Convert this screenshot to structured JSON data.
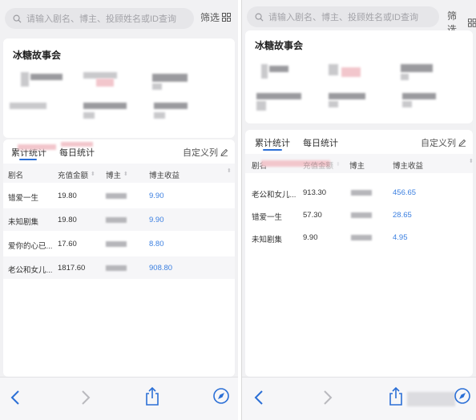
{
  "left": {
    "search": {
      "placeholder": "请输入剧名、博主、投顾姓名或ID查询"
    },
    "filter_label": "筛选",
    "header_title": "冰糖故事会",
    "tabs": [
      {
        "label": "累计统计"
      },
      {
        "label": "每日统计"
      }
    ],
    "customize_label": "自定义列",
    "columns": [
      "剧名",
      "充值金额",
      "博主",
      "博主收益"
    ],
    "rows": [
      {
        "title": "错爱一生",
        "amount": "19.80",
        "earnings": "9.90"
      },
      {
        "title": "未知剧集",
        "amount": "19.80",
        "earnings": "9.90"
      },
      {
        "title": "爱你的心已...",
        "amount": "17.60",
        "earnings": "8.80"
      },
      {
        "title": "老公和女儿...",
        "amount": "1817.60",
        "earnings": "908.80"
      }
    ]
  },
  "right": {
    "search": {
      "placeholder": "请输入剧名、博主、投顾姓名或ID查询"
    },
    "filter_label": "筛选",
    "header_title": "冰糖故事会",
    "tabs": [
      {
        "label": "累计统计"
      },
      {
        "label": "每日统计"
      }
    ],
    "customize_label": "自定义列",
    "columns": [
      "剧名",
      "充值金额",
      "博主",
      "博主收益"
    ],
    "rows": [
      {
        "title": "老公和女儿...",
        "amount": "913.30",
        "earnings": "456.65"
      },
      {
        "title": "错爱一生",
        "amount": "57.30",
        "earnings": "28.65"
      },
      {
        "title": "未知剧集",
        "amount": "9.90",
        "earnings": "4.95"
      }
    ]
  },
  "colors": {
    "accent": "#2b6fd6",
    "link": "#3b7fe0",
    "background": "#f1f1f3"
  },
  "icons": [
    "search-icon",
    "grid-icon",
    "edit-icon",
    "back-icon",
    "forward-icon",
    "share-icon",
    "compass-icon"
  ]
}
